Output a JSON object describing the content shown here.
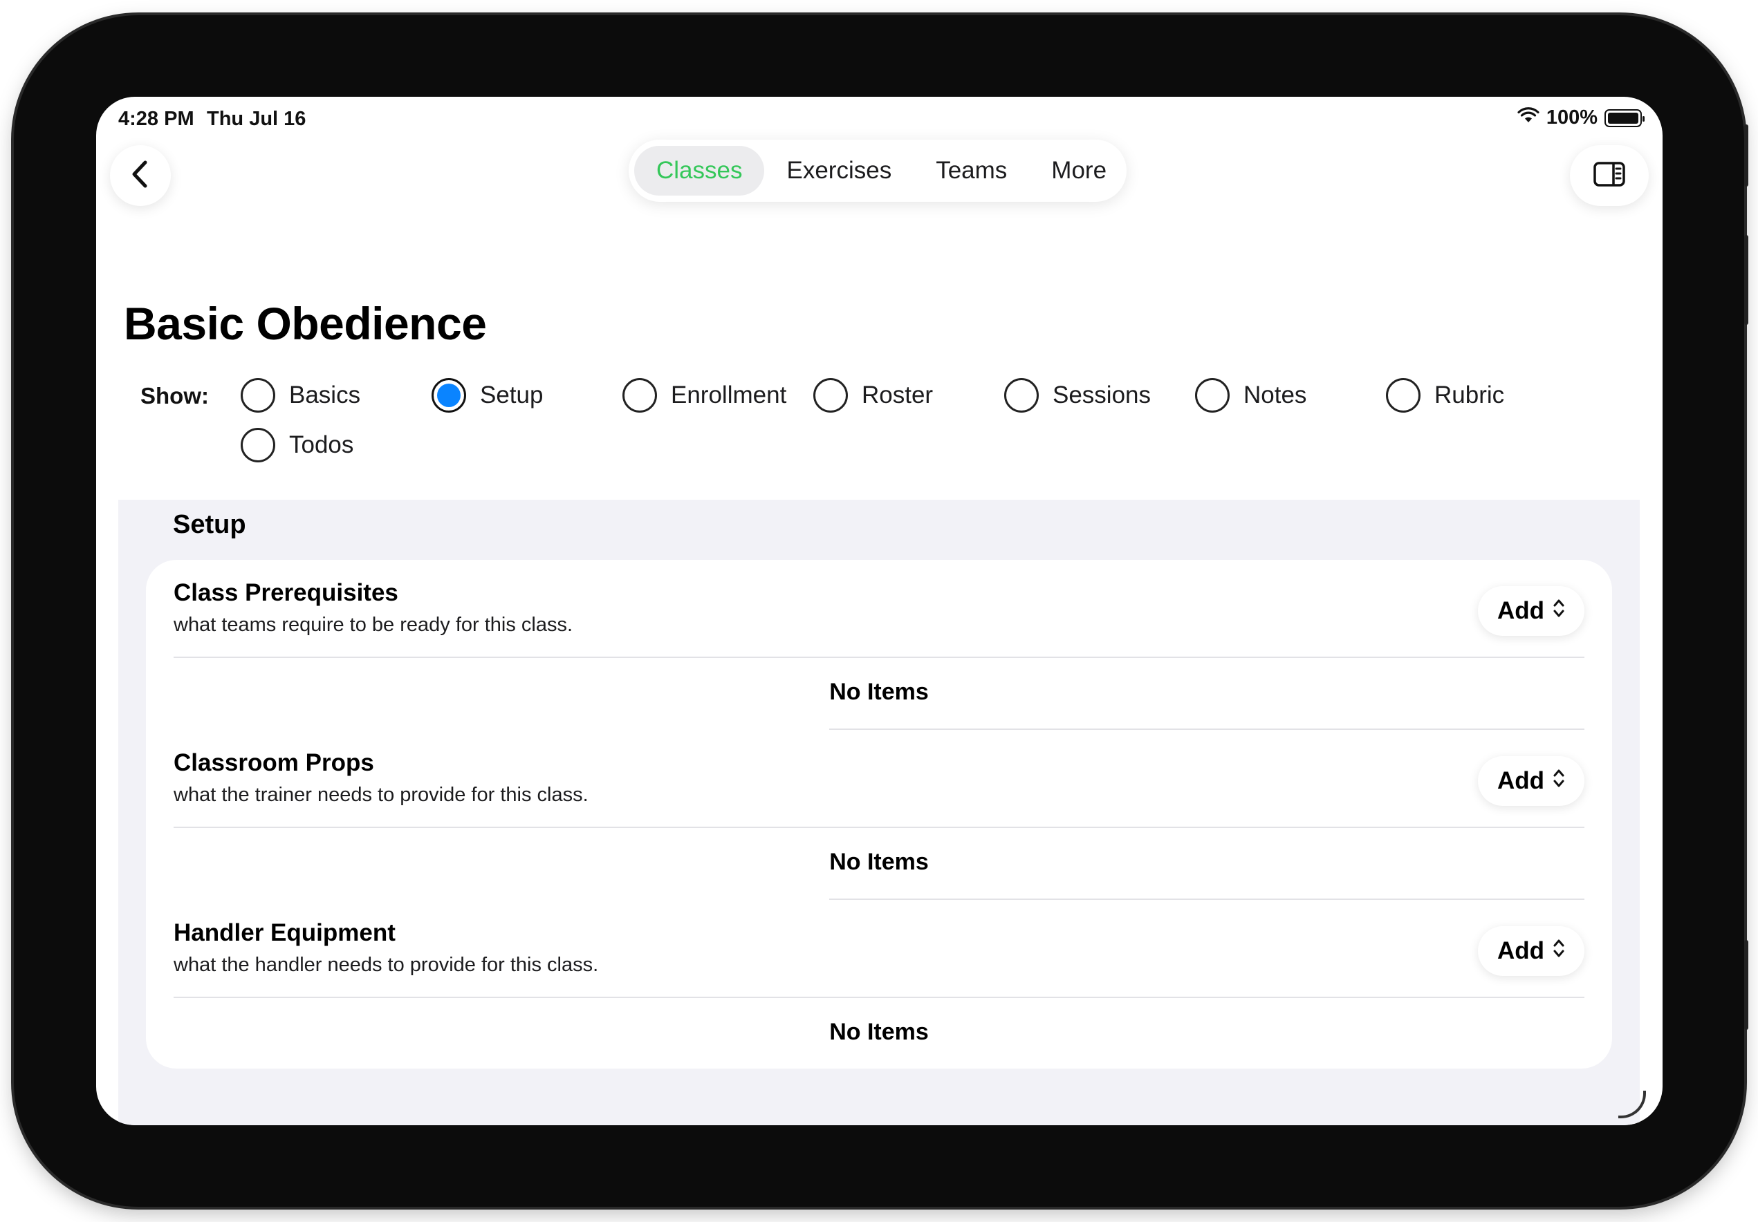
{
  "status_bar": {
    "time": "4:28 PM",
    "date": "Thu Jul 16",
    "battery": "100%"
  },
  "nav": {
    "tabs": [
      {
        "label": "Classes",
        "active": true
      },
      {
        "label": "Exercises",
        "active": false
      },
      {
        "label": "Teams",
        "active": false
      },
      {
        "label": "More",
        "active": false
      }
    ]
  },
  "page": {
    "title": "Basic Obedience"
  },
  "show": {
    "label": "Show:",
    "options": [
      {
        "label": "Basics",
        "selected": false
      },
      {
        "label": "Setup",
        "selected": true
      },
      {
        "label": "Enrollment",
        "selected": false
      },
      {
        "label": "Roster",
        "selected": false
      },
      {
        "label": "Sessions",
        "selected": false
      },
      {
        "label": "Notes",
        "selected": false
      },
      {
        "label": "Rubric",
        "selected": false
      },
      {
        "label": "Todos",
        "selected": false
      }
    ]
  },
  "setup": {
    "title": "Setup",
    "groups": [
      {
        "title": "Class Prerequisites",
        "description": "what teams require to be ready for this class.",
        "add_label": "Add",
        "empty_label": "No Items"
      },
      {
        "title": "Classroom Props",
        "description": "what the trainer needs to provide for this class.",
        "add_label": "Add",
        "empty_label": "No Items"
      },
      {
        "title": "Handler Equipment",
        "description": "what the handler needs to provide for this class.",
        "add_label": "Add",
        "empty_label": "No Items"
      }
    ]
  },
  "colors": {
    "accent_green": "#34c759",
    "radio_blue": "#0a84ff",
    "section_bg": "#f2f2f7"
  }
}
